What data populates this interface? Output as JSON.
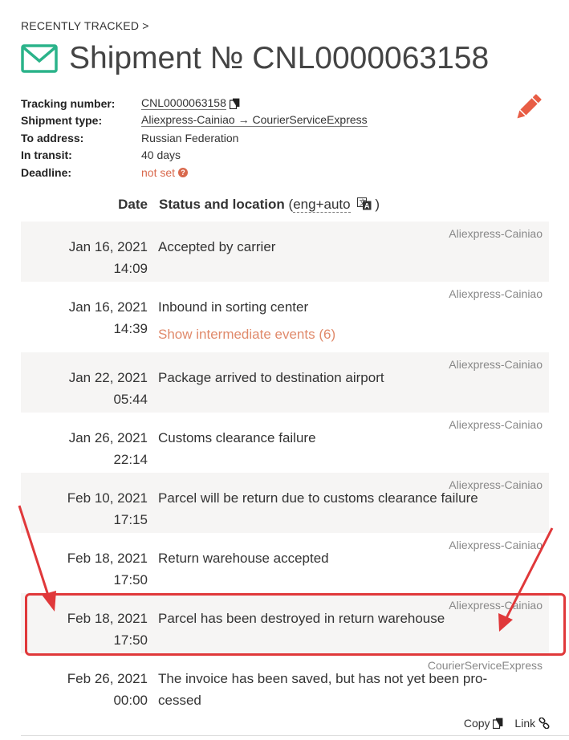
{
  "breadcrumb": "RECENTLY TRACKED >",
  "title": "Shipment № CNL0000063158",
  "meta": {
    "tracking_label": "Tracking number:",
    "tracking_value": "CNL0000063158",
    "type_label": "Shipment type:",
    "type_value": "Aliexpress-Cainiao → CourierServiceExpress",
    "address_label": "To address:",
    "address_value": "Russian Federation",
    "transit_label": "In transit:",
    "transit_value": "40 days",
    "deadline_label": "Deadline:",
    "deadline_value": "not set"
  },
  "table": {
    "date_header": "Date",
    "status_header": "Status and location",
    "lang_open": "(",
    "lang": "eng+auto",
    "lang_close": ")"
  },
  "events": [
    {
      "date": "Jan 16, 2021",
      "time": "14:09",
      "status": "Accepted by carrier",
      "carrier": "Aliexpress-Cainiao"
    },
    {
      "date": "Jan 16, 2021",
      "time": "14:39",
      "status": "Inbound in sorting center",
      "carrier": "Aliexpress-Cainiao",
      "extra": "Show intermediate events (6)"
    },
    {
      "date": "Jan 22, 2021",
      "time": "05:44",
      "status": "Package arrived to destination airport",
      "carrier": "Aliexpress-Cainiao"
    },
    {
      "date": "Jan 26, 2021",
      "time": "22:14",
      "status": "Customs clearance failure",
      "carrier": "Aliexpress-Cainiao"
    },
    {
      "date": "Feb 10, 2021",
      "time": "17:15",
      "status": "Parcel will be return due to customs clearance failure",
      "carrier": "Aliexpress-Cainiao"
    },
    {
      "date": "Feb 18, 2021",
      "time": "17:50",
      "status": "Return warehouse accepted",
      "carrier": "Aliexpress-Cainiao"
    },
    {
      "date": "Feb 18, 2021",
      "time": "17:50",
      "status": "Parcel has been destroyed in return warehouse",
      "carrier": "Aliexpress-Cainiao"
    },
    {
      "date": "Feb 26, 2021",
      "time": "00:00",
      "status": "The invoice has been saved, but has not yet been pro-cessed",
      "carrier": "CourierServiceExpress"
    }
  ],
  "footer": {
    "copy": "Copy",
    "link": "Link"
  },
  "colors": {
    "accent": "#2bb38a",
    "warning": "#d9694d",
    "highlight": "#e0383a",
    "row_alt": "#f6f5f4"
  }
}
